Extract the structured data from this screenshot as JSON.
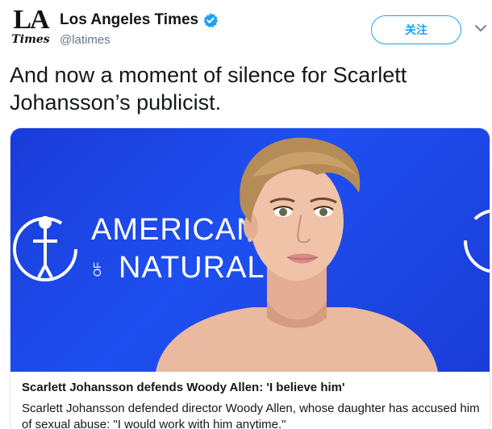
{
  "account": {
    "name": "Los Angeles Times",
    "handle": "@latimes",
    "avatar_text_top": "LA",
    "avatar_text_bottom": "Times"
  },
  "follow_button": {
    "label": "关注"
  },
  "tweet": {
    "text": "And now a moment of silence for Scarlett Johansson’s publicist."
  },
  "card": {
    "image": {
      "backdrop_text_line1": "AMERICAN",
      "backdrop_text_line2": "NATURAL H",
      "backdrop_text_prefix": "OF",
      "backdrop_color": "#1f4ff0"
    },
    "title": "Scarlett Johansson defends Woody Allen: 'I believe him'",
    "description": "Scarlett Johansson defended director Woody Allen, whose daughter has accused him of sexual abuse: \"I would work with him anytime.\""
  },
  "colors": {
    "accent": "#1da1f2",
    "text_primary": "#14171a",
    "text_secondary": "#657786"
  },
  "icons": [
    "verified-badge-icon",
    "chevron-down-icon",
    "museum-logo-icon"
  ]
}
